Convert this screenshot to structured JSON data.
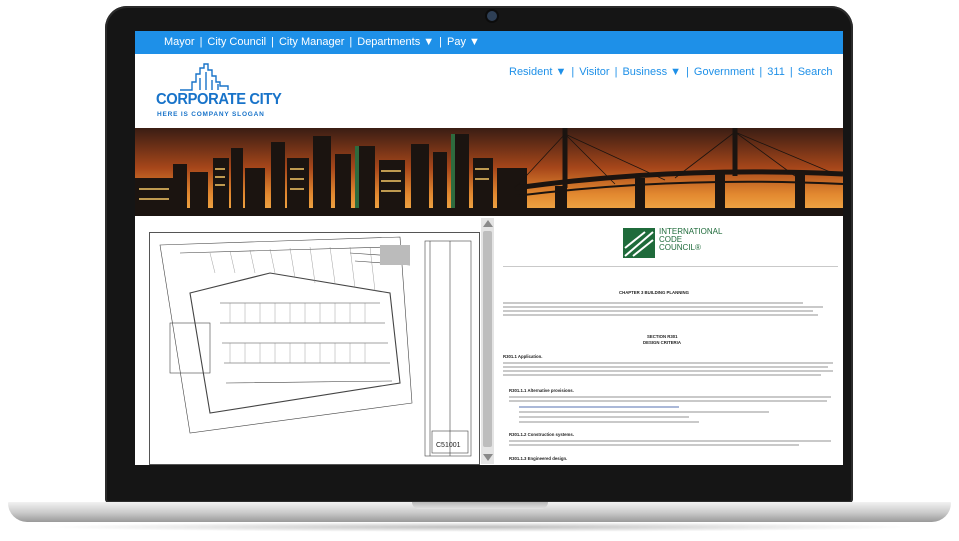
{
  "top_nav": {
    "mayor": "Mayor",
    "city_council": "City Council",
    "city_manager": "City Manager",
    "departments": "Departments ▼",
    "pay": "Pay ▼",
    "separator": "|"
  },
  "logo": {
    "title": "CORPORATE CITY",
    "slogan": "HERE IS COMPANY SLOGAN"
  },
  "main_nav": {
    "resident": "Resident ▼",
    "visitor": "Visitor",
    "business": "Business ▼",
    "government": "Government",
    "n311": "311",
    "search": "Search",
    "separator": "|"
  },
  "plan_viewer": {
    "sheet_number": "C51001"
  },
  "document": {
    "publisher_logo_text": "INTERNATIONAL\nCODE\nCOUNCIL®",
    "chapter_title": "CHAPTER 3 BUILDING PLANNING",
    "section_title": "SECTION R301",
    "section_subtitle": "DESIGN CRITERIA",
    "heading_1": "R301.1 Application.",
    "heading_2": "R301.1.1 Alternative provisions.",
    "heading_3": "R301.1.2 Construction systems.",
    "heading_4": "R301.1.3 Engineered design."
  },
  "colors": {
    "nav_blue": "#1e90e8",
    "logo_blue": "#1873c9",
    "icc_green": "#1f6b3b"
  }
}
